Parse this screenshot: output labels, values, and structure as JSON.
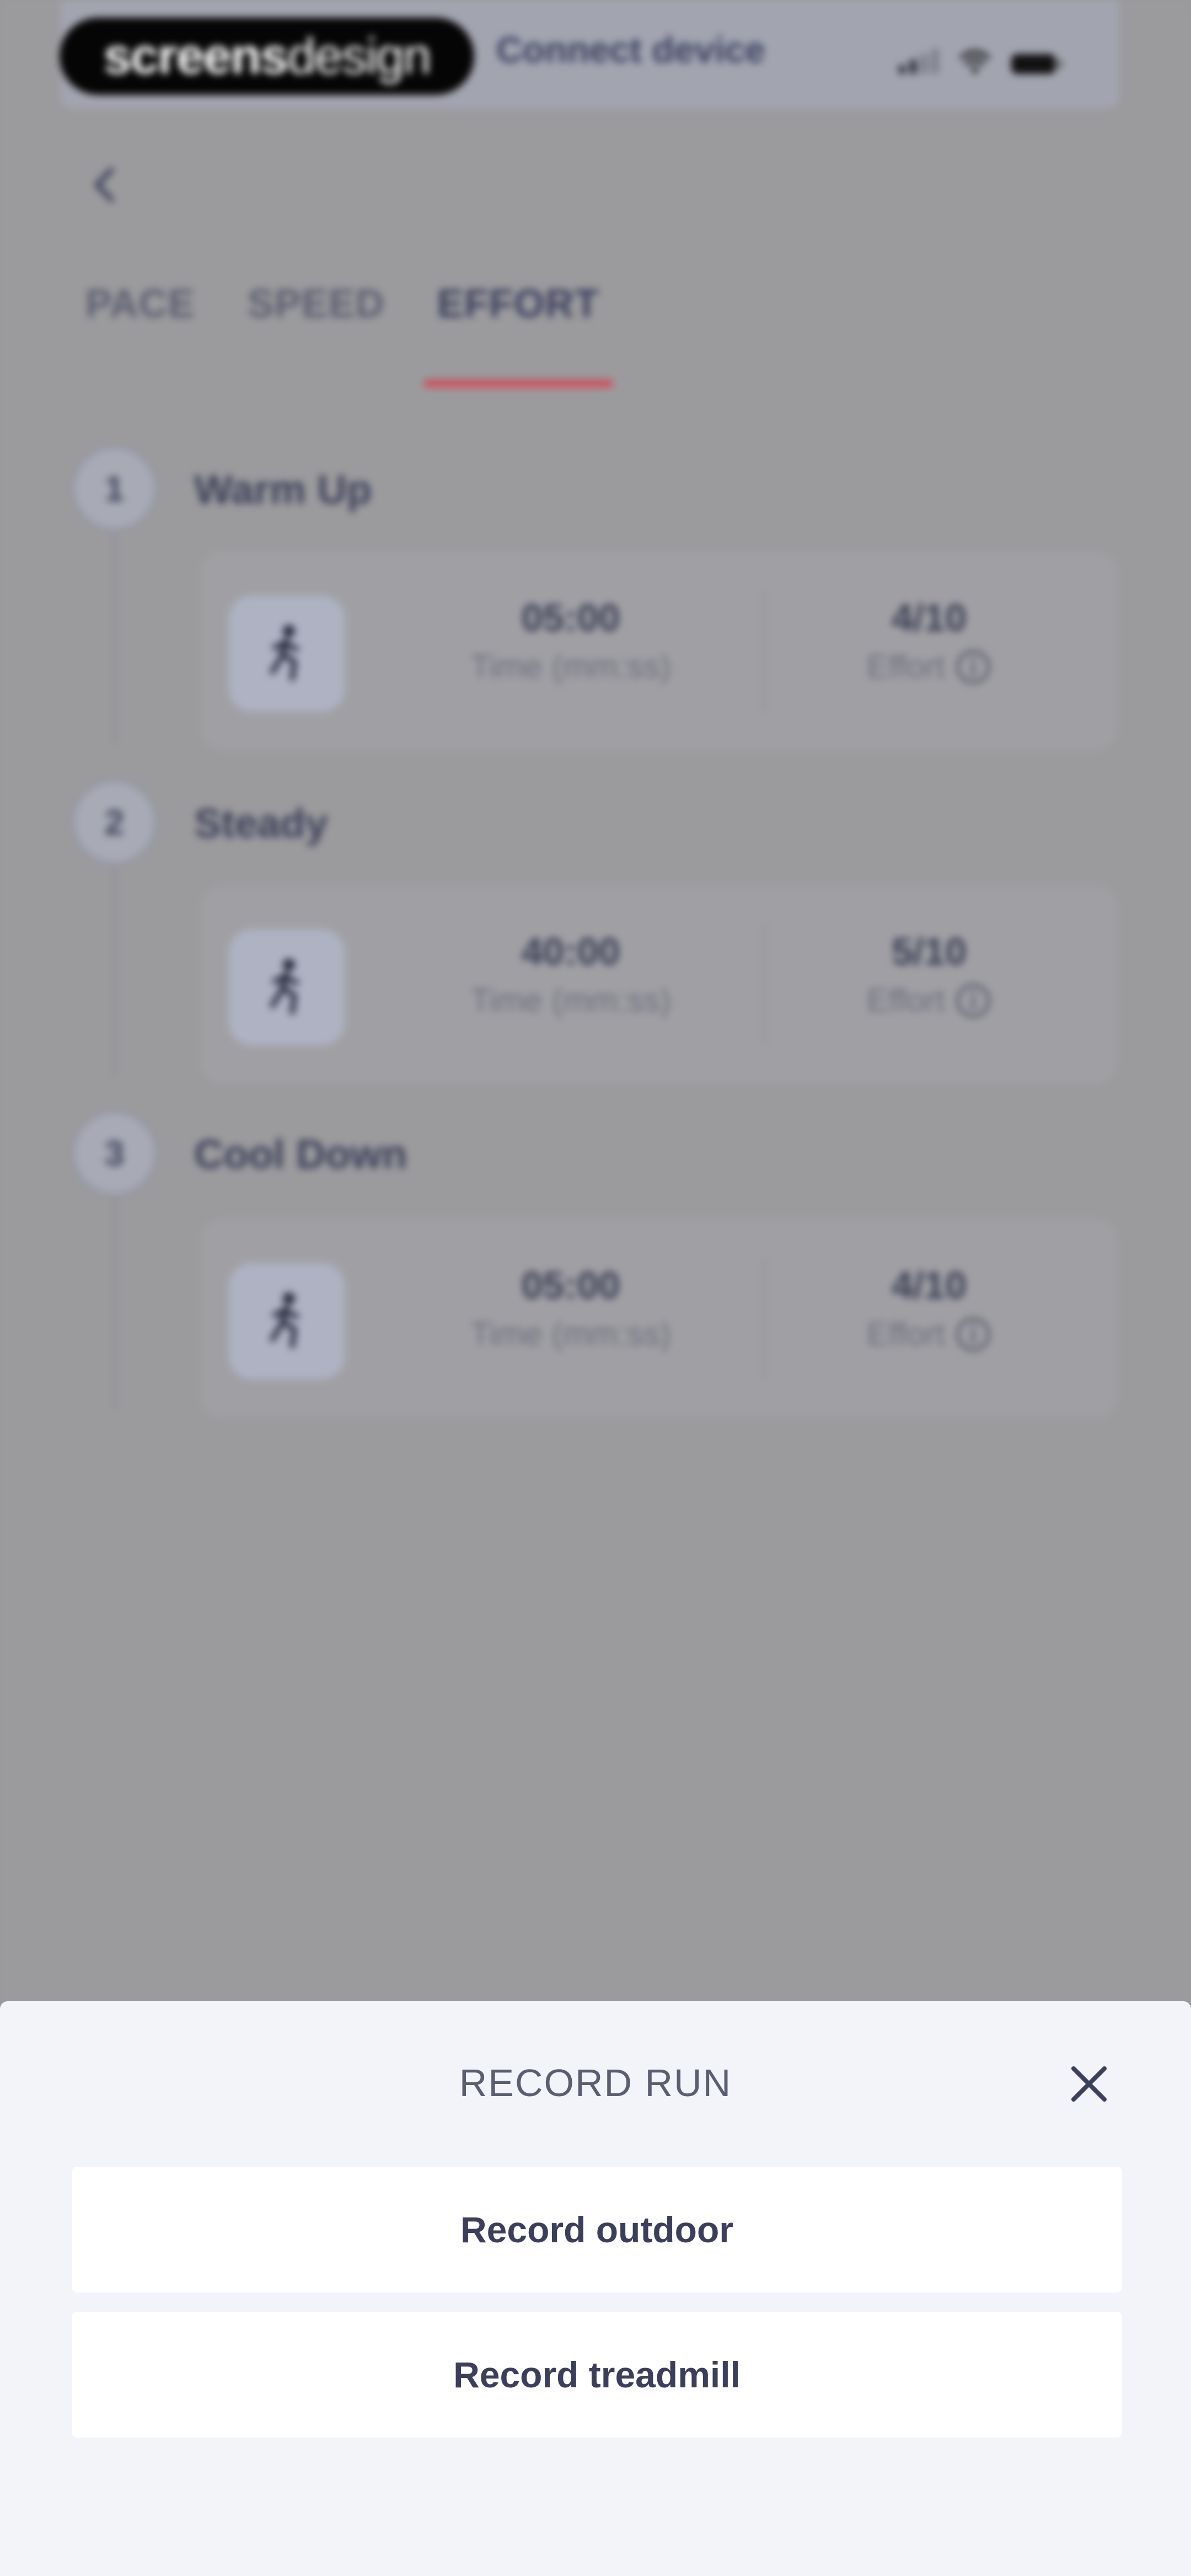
{
  "status_bar": {
    "brand_bold": "screens",
    "brand_light": "design",
    "connect_label": "Connect device"
  },
  "tabs": [
    {
      "label": "PACE",
      "active": false
    },
    {
      "label": "SPEED",
      "active": false
    },
    {
      "label": "EFFORT",
      "active": true
    }
  ],
  "steps": [
    {
      "number": "1",
      "title": "Warm Up",
      "time_value": "05:00",
      "time_label": "Time (mm:ss)",
      "effort_value": "4/10",
      "effort_label": "Effort",
      "icon": "runner-icon"
    },
    {
      "number": "2",
      "title": "Steady",
      "time_value": "40:00",
      "time_label": "Time (mm:ss)",
      "effort_value": "5/10",
      "effort_label": "Effort",
      "icon": "runner-icon"
    },
    {
      "number": "3",
      "title": "Cool Down",
      "time_value": "05:00",
      "time_label": "Time (mm:ss)",
      "effort_value": "4/10",
      "effort_label": "Effort",
      "icon": "runner-icon"
    }
  ],
  "sheet": {
    "title": "RECORD RUN",
    "buttons": [
      {
        "label": "Record outdoor"
      },
      {
        "label": "Record treadmill"
      }
    ]
  },
  "colors": {
    "accent": "#cf4e58",
    "overlay": "#9b9b9d",
    "sheet_bg": "#f2f4fa",
    "text_dark": "#3b3f5c"
  }
}
